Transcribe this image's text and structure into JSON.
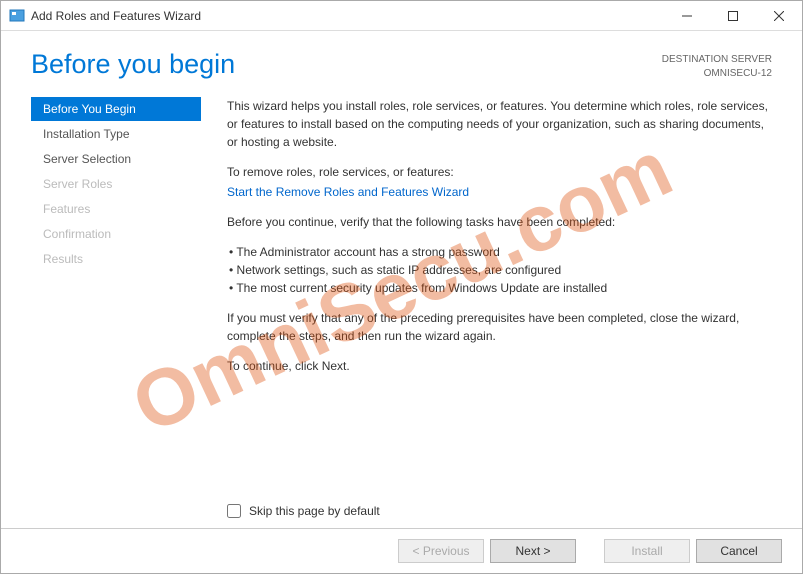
{
  "titlebar": {
    "title": "Add Roles and Features Wizard"
  },
  "header": {
    "page_title": "Before you begin",
    "dest_label": "DESTINATION SERVER",
    "dest_name": "OMNISECU-12"
  },
  "sidebar": {
    "items": [
      {
        "label": "Before You Begin",
        "state": "active"
      },
      {
        "label": "Installation Type",
        "state": "enabled"
      },
      {
        "label": "Server Selection",
        "state": "enabled"
      },
      {
        "label": "Server Roles",
        "state": "disabled"
      },
      {
        "label": "Features",
        "state": "disabled"
      },
      {
        "label": "Confirmation",
        "state": "disabled"
      },
      {
        "label": "Results",
        "state": "disabled"
      }
    ]
  },
  "main": {
    "intro": "This wizard helps you install roles, role services, or features. You determine which roles, role services, or features to install based on the computing needs of your organization, such as sharing documents, or hosting a website.",
    "remove_label": "To remove roles, role services, or features:",
    "remove_link": "Start the Remove Roles and Features Wizard",
    "verify_label": "Before you continue, verify that the following tasks have been completed:",
    "bullets": [
      "The Administrator account has a strong password",
      "Network settings, such as static IP addresses, are configured",
      "The most current security updates from Windows Update are installed"
    ],
    "close_note": "If you must verify that any of the preceding prerequisites have been completed, close the wizard, complete the steps, and then run the wizard again.",
    "continue_note": "To continue, click Next.",
    "skip_label": "Skip this page by default"
  },
  "footer": {
    "previous": "< Previous",
    "next": "Next >",
    "install": "Install",
    "cancel": "Cancel"
  },
  "watermark": "OmniSecu.com"
}
